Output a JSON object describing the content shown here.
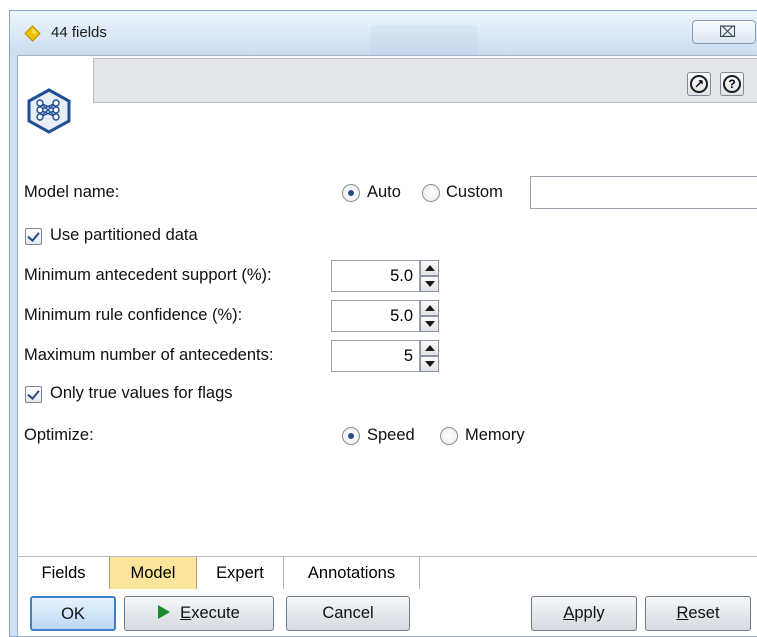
{
  "window": {
    "title": "44 fields",
    "close_glyph": "⌧"
  },
  "header": {
    "node_icon": "network-node-icon",
    "description": "",
    "buttons": [
      "launch-icon",
      "help-icon"
    ]
  },
  "form": {
    "model_name": {
      "label": "Model name:",
      "options": [
        "Auto",
        "Custom"
      ],
      "selected": "Auto",
      "custom_value": ""
    },
    "use_partitioned": {
      "label": "Use partitioned data",
      "checked": true
    },
    "min_antecedent_support": {
      "label": "Minimum antecedent support (%):",
      "value": "5.0"
    },
    "min_rule_confidence": {
      "label": "Minimum rule confidence (%):",
      "value": "5.0"
    },
    "max_antecedents": {
      "label": "Maximum number of antecedents:",
      "value": "5"
    },
    "only_true_flags": {
      "label": "Only true values for flags",
      "checked": true
    },
    "optimize": {
      "label": "Optimize:",
      "options": [
        "Speed",
        "Memory"
      ],
      "selected": "Speed"
    }
  },
  "tabs": [
    {
      "label": "Fields",
      "active": false
    },
    {
      "label": "Model",
      "active": true
    },
    {
      "label": "Expert",
      "active": false
    },
    {
      "label": "Annotations",
      "active": false
    }
  ],
  "buttons": {
    "ok": "OK",
    "execute_prefix": "E",
    "execute_rest": "xecute",
    "cancel": "Cancel",
    "apply_prefix": "A",
    "apply_rest": "pply",
    "reset_prefix": "R",
    "reset_rest": "eset"
  },
  "colors": {
    "active_tab": "#fbe59c",
    "frame": "#cfe0f2",
    "default_button_border": "#3f7fc8"
  }
}
